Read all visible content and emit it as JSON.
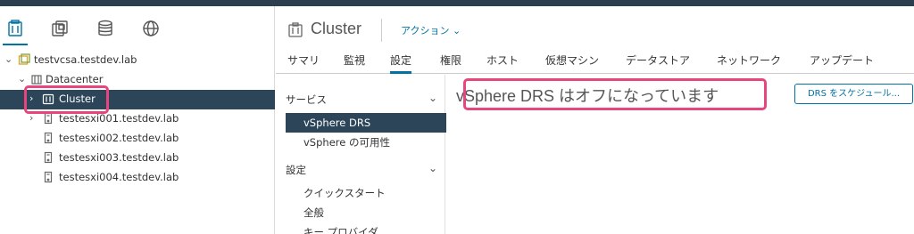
{
  "navigator": {
    "tabs": [
      {
        "icon": "hosts-clusters-icon",
        "active": true
      },
      {
        "icon": "vms-templates-icon",
        "active": false
      },
      {
        "icon": "storage-icon",
        "active": false
      },
      {
        "icon": "networking-icon",
        "active": false
      }
    ],
    "tree": {
      "vcenter": "testvcsa.testdev.lab",
      "datacenter": "Datacenter",
      "cluster": "Cluster",
      "hosts": [
        "testesxi001.testdev.lab",
        "testesxi002.testdev.lab",
        "testesxi003.testdev.lab",
        "testesxi004.testdev.lab"
      ]
    }
  },
  "object": {
    "title": "Cluster",
    "actions_label": "アクション ⌄"
  },
  "tabs": [
    "サマリ",
    "監視",
    "設定",
    "権限",
    "ホスト",
    "仮想マシン",
    "データストア",
    "ネットワーク",
    "アップデート"
  ],
  "active_tab": "設定",
  "sub_nav": {
    "services_header": "サービス",
    "services": [
      "vSphere DRS",
      "vSphere の可用性"
    ],
    "settings_header": "設定",
    "settings": [
      "クイックスタート",
      "全般",
      "キー プロバイダ"
    ]
  },
  "content": {
    "title": "vSphere DRS はオフになっています",
    "schedule_button": "DRS をスケジュール..."
  },
  "colors": {
    "accent": "#0072a3",
    "selected_bg": "#2d4559",
    "highlight": "#e8457f"
  }
}
